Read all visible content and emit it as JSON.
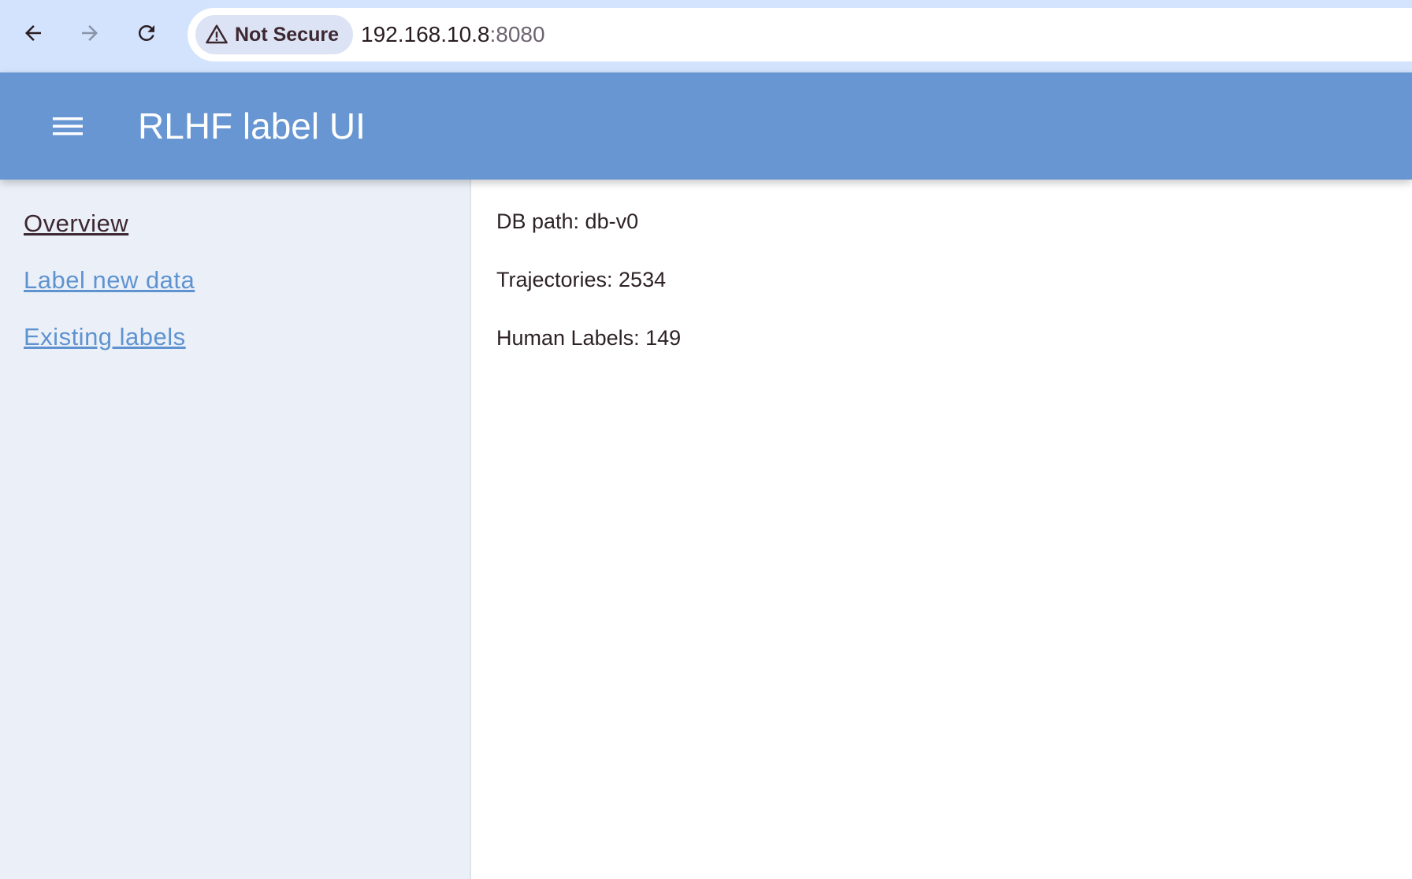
{
  "browser": {
    "back_icon": "arrow-left-icon",
    "forward_icon": "arrow-right-icon",
    "reload_icon": "reload-icon",
    "security_icon": "warning-triangle-icon",
    "security_label": "Not Secure",
    "url_host": "192.168.10.8",
    "url_port": ":8080"
  },
  "header": {
    "menu_icon": "hamburger-menu-icon",
    "title": "RLHF label UI",
    "background_color": "#6796d2"
  },
  "sidebar": {
    "items": [
      {
        "label": "Overview",
        "active": true
      },
      {
        "label": "Label new data",
        "active": false
      },
      {
        "label": "Existing labels",
        "active": false
      }
    ]
  },
  "main": {
    "db_path": "DB path: db-v0",
    "trajectories": "Trajectories: 2534",
    "human_labels": "Human Labels: 149"
  },
  "colors": {
    "link": "#5f93d0",
    "active_link": "#3d2730",
    "sidebar_bg": "#ebf0f8",
    "browser_bar": "#d3e3fd"
  }
}
